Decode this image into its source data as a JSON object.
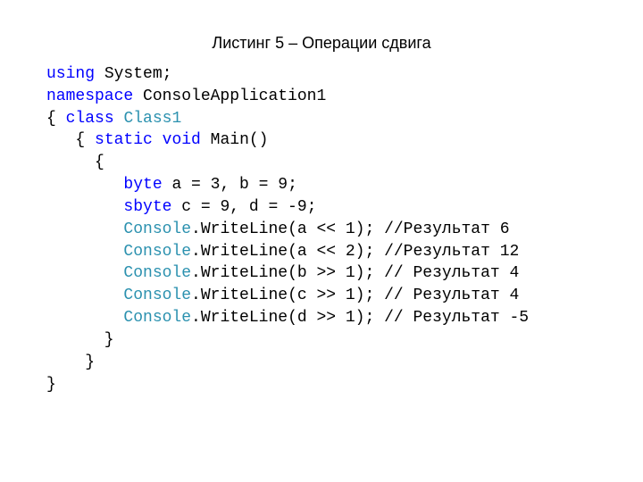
{
  "title": "Листинг 5 – Операции сдвига",
  "code": {
    "l1a": "using",
    "l1b": " System;",
    "l2a": "namespace",
    "l2b": " ConsoleApplication1",
    "l3a": "{ ",
    "l3b": "class",
    "l3c": " ",
    "l3d": "Class1",
    "l4a": "   { ",
    "l4b": "static",
    "l4c": " ",
    "l4d": "void",
    "l4e": " Main()",
    "l5": "     {",
    "l6a": "        ",
    "l6b": "byte",
    "l6c": " a = 3, b = 9;",
    "l7a": "        ",
    "l7b": "sbyte",
    "l7c": " c = 9, d = -9;",
    "l8a": "        ",
    "l8b": "Console",
    "l8c": ".WriteLine(a << 1); //Результат 6",
    "l9a": "        ",
    "l9b": "Console",
    "l9c": ".WriteLine(a << 2); //Результат 12",
    "l10a": "        ",
    "l10b": "Console",
    "l10c": ".WriteLine(b >> 1); // Результат 4",
    "l11a": "        ",
    "l11b": "Console",
    "l11c": ".WriteLine(c >> 1); // Результат 4",
    "l12a": "        ",
    "l12b": "Console",
    "l12c": ".WriteLine(d >> 1); // Результат -5",
    "l13": "      }",
    "l14": "    }",
    "l15": "}"
  }
}
